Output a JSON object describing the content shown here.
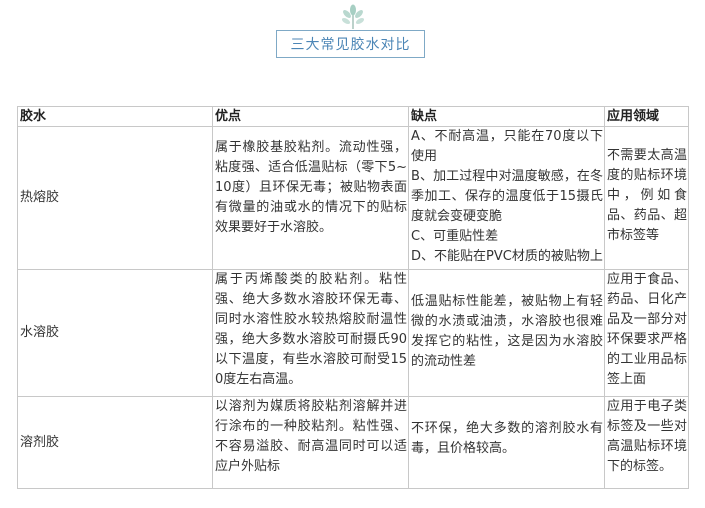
{
  "page": {
    "title": "三大常见胶水对比",
    "accent_color": "#4c86b6",
    "decoration_icon": "leaf-sprig-icon"
  },
  "table": {
    "headers": [
      "胶水",
      "优点",
      "缺点",
      "应用领域"
    ],
    "rows": [
      {
        "name": "热熔胶",
        "pros": "属于橡胶基胶粘剂。流动性强，粘度强、适合低温贴标（零下5~10度）且环保无毒；被贴物表面有微量的油或水的情况下的贴标效果要好于水溶胶。",
        "cons": [
          "A、不耐高温，只能在70度以下使用",
          "B、加工过程中对温度敏感，在冬季加工、保存的温度低于15摄氏度就会变硬变脆",
          "C、可重贴性差",
          "D、不能贴在PVC材质的被贴物上"
        ],
        "uses": "不需要太高温度的贴标环境中，例如食品、药品、超市标签等"
      },
      {
        "name": "水溶胶",
        "pros": "属于丙烯酸类的胶粘剂。粘性强、绝大多数水溶胶环保无毒、同时水溶性胶水较热熔胶耐温性强，绝大多数水溶胶可耐摄氏90以下温度，有些水溶胶可耐受150度左右高温。",
        "cons": [
          "低温贴标性能差，被贴物上有轻微的水渍或油渍，水溶胶也很难发挥它的粘性，这是因为水溶胶的流动性差"
        ],
        "uses": "应用于食品、药品、日化产品及一部分对环保要求严格的工业用品标签上面"
      },
      {
        "name": "溶剂胶",
        "pros": "以溶剂为媒质将胶粘剂溶解并进行涂布的一种胶粘剂。粘性强、不容易溢胶、耐高温同时可以适应户外贴标",
        "cons": [
          "不环保，绝大多数的溶剂胶水有毒，且价格较高。"
        ],
        "uses": "应用于电子类标签及一些对高温贴标环境下的标签。"
      }
    ]
  }
}
